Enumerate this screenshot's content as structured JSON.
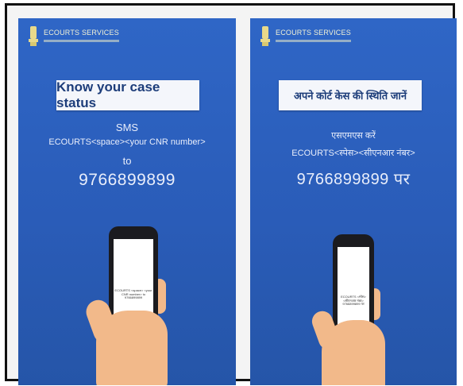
{
  "posters": [
    {
      "brand": "ECOURTS SERVICES",
      "title": "Know your case status",
      "sms_label": "SMS",
      "format": "ECOURTS<space><your CNR number>",
      "to_label": "to",
      "number": "9766899899",
      "phone_screen_text": "ECOURTS <space> <your CNR number> to 9766899899"
    },
    {
      "brand": "ECOURTS SERVICES",
      "title": "अपने कोर्ट केस की स्थिति जानें",
      "sms_label": "एसएमएस करें",
      "format": "ECOURTS<स्पेस><सीएनआर नंबर>",
      "number": "9766899899 पर",
      "phone_screen_text": "ECOURTS <स्पेस> <सीएनआर नंबर> 9766899899 पर"
    }
  ],
  "colors": {
    "poster_bg": "#2f66c6",
    "banner_bg": "#f4f6fb",
    "text": "#e9eefb",
    "hand": "#f2b98a"
  }
}
